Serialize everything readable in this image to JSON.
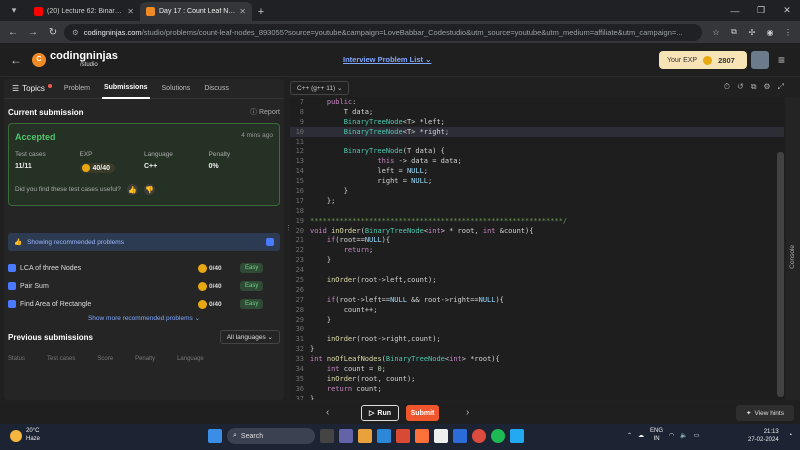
{
  "browser": {
    "tabs": [
      {
        "title": "(20) Lecture 62: Binary Trees &",
        "favicon_color": "#ff0000"
      },
      {
        "title": "Day 17 : Count Leaf Nodes - Co",
        "favicon_color": "#f08a24"
      }
    ],
    "url_host": "codingninjas.com",
    "url_rest": "/studio/problems/count-leaf-nodes_893055?source=youtube&campaign=LoveBabbar_Codestudio&utm_source=youtube&utm_medium=affiliate&utm_campaign=..."
  },
  "header": {
    "brand": "codingninjas",
    "brand_sub": "/studio",
    "problem_list_link": "Interview Problem List",
    "exp_label": "Your EXP",
    "exp_value": "2807"
  },
  "left_tabs": {
    "topics": "Topics",
    "problem": "Problem",
    "submissions": "Submissions",
    "solutions": "Solutions",
    "discuss": "Discuss"
  },
  "current_submission": {
    "title": "Current submission",
    "report": "Report",
    "status": "Accepted",
    "time_ago": "4 mins ago",
    "stats": [
      {
        "label": "Test cases",
        "value": "11/11"
      },
      {
        "label": "EXP",
        "value": "40/40"
      },
      {
        "label": "Language",
        "value": "C++"
      },
      {
        "label": "Penalty",
        "value": "0%"
      }
    ],
    "useful_prompt": "Did you find these test cases useful?"
  },
  "recommended": {
    "toggle_label": "Showing recommended problems",
    "items": [
      {
        "name": "LCA of three Nodes",
        "points": "0/40",
        "difficulty": "Easy"
      },
      {
        "name": "Pair Sum",
        "points": "0/40",
        "difficulty": "Easy"
      },
      {
        "name": "Find Area of Rectangle",
        "points": "0/40",
        "difficulty": "Easy"
      }
    ],
    "show_more": "Show more recommended problems"
  },
  "previous": {
    "title": "Previous submissions",
    "language_filter": "All languages",
    "columns": [
      "Status",
      "Test cases",
      "Score",
      "Penalty",
      "Language"
    ]
  },
  "editor": {
    "language": "C++ (g++ 11)",
    "highlighted_line": 10,
    "lines": [
      {
        "n": "7",
        "text": "    public:"
      },
      {
        "n": "8",
        "text": "        T data;"
      },
      {
        "n": "9",
        "text": "        BinaryTreeNode<T> *left;"
      },
      {
        "n": "10",
        "text": "        BinaryTreeNode<T> *right;"
      },
      {
        "n": "11",
        "text": ""
      },
      {
        "n": "12",
        "text": "        BinaryTreeNode(T data) {"
      },
      {
        "n": "13",
        "text": "                this -> data = data;"
      },
      {
        "n": "14",
        "text": "                left = NULL;"
      },
      {
        "n": "15",
        "text": "                right = NULL;"
      },
      {
        "n": "16",
        "text": "        }"
      },
      {
        "n": "17",
        "text": "    };"
      },
      {
        "n": "18",
        "text": ""
      },
      {
        "n": "19",
        "text": "************************************************************/"
      },
      {
        "n": "20",
        "text": "void inOrder(BinaryTreeNode<int> * root, int &count){"
      },
      {
        "n": "21",
        "text": "    if(root==NULL){"
      },
      {
        "n": "22",
        "text": "        return;"
      },
      {
        "n": "23",
        "text": "    }"
      },
      {
        "n": "24",
        "text": ""
      },
      {
        "n": "25",
        "text": "    inOrder(root->left,count);"
      },
      {
        "n": "26",
        "text": ""
      },
      {
        "n": "27",
        "text": "    if(root->left==NULL && root->right==NULL){"
      },
      {
        "n": "28",
        "text": "        count++;"
      },
      {
        "n": "29",
        "text": "    }"
      },
      {
        "n": "30",
        "text": ""
      },
      {
        "n": "31",
        "text": "    inOrder(root->right,count);"
      },
      {
        "n": "32",
        "text": "}"
      },
      {
        "n": "33",
        "text": "int noOfLeafNodes(BinaryTreeNode<int> *root){"
      },
      {
        "n": "34",
        "text": "    int count = 0;"
      },
      {
        "n": "35",
        "text": "    inOrder(root, count);"
      },
      {
        "n": "36",
        "text": "    return count;"
      },
      {
        "n": "37",
        "text": "}"
      }
    ],
    "console_label": "Console"
  },
  "actions": {
    "run": "Run",
    "submit": "Submit",
    "view_hints": "View hints"
  },
  "taskbar": {
    "temp": "20°C",
    "weather": "Haze",
    "search": "Search",
    "lang1": "ENG",
    "lang2": "IN",
    "time": "21:13",
    "date": "27-02-2024"
  }
}
